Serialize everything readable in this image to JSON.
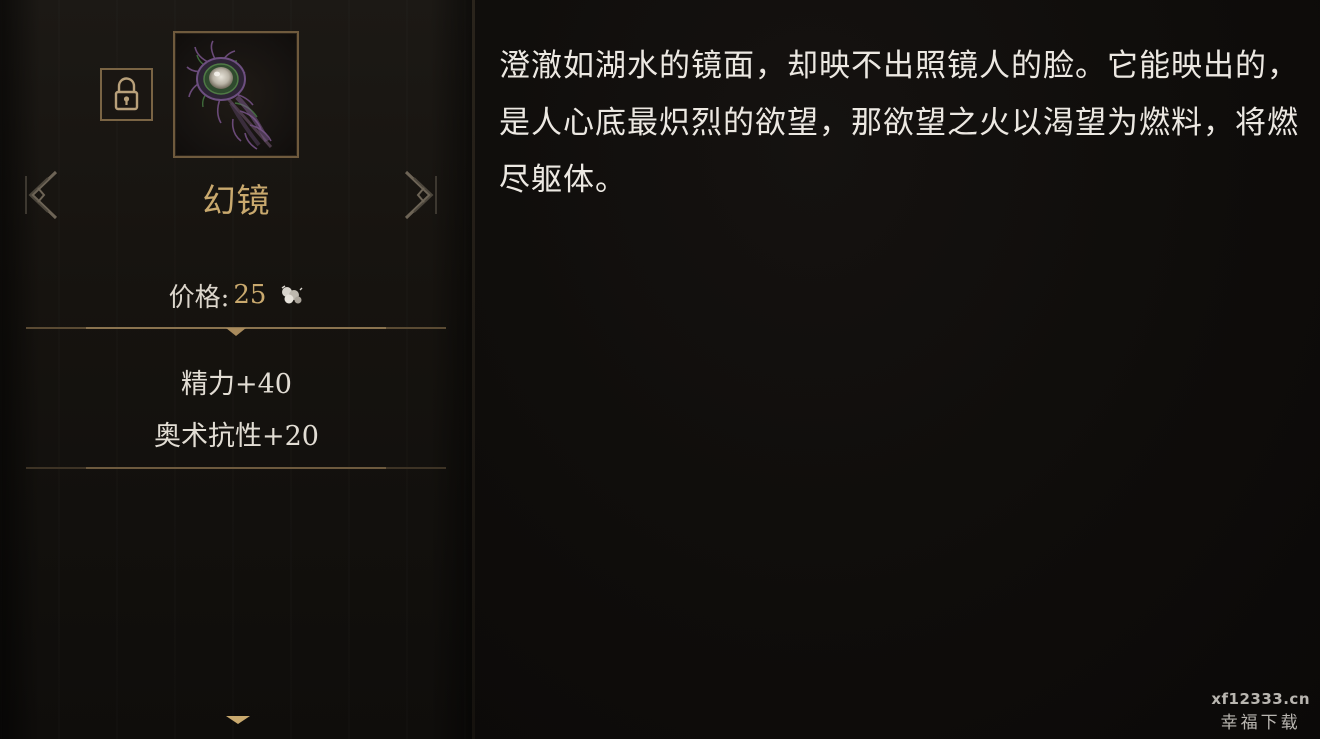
{
  "item": {
    "name": "幻镜",
    "icon": "peacock-feather-icon",
    "locked_icon": "lock-icon"
  },
  "price": {
    "label": "价格:",
    "value": "25",
    "currency_icon": "gold-coins-icon"
  },
  "stats": [
    {
      "text": "精力+40"
    },
    {
      "text": "奥术抗性+20"
    }
  ],
  "description": "澄澈如湖水的镜面，却映不出照镜人的脸。它能映出的，是人心底最炽烈的欲望，那欲望之火以渴望为燃料，将燃尽躯体。",
  "watermark": {
    "url": "xf12333.cn",
    "name": "幸福下载"
  },
  "colors": {
    "gold": "#c9a96e",
    "text": "#ece8e2",
    "frame": "#6f5a3d",
    "background": "#0d0b0a"
  }
}
